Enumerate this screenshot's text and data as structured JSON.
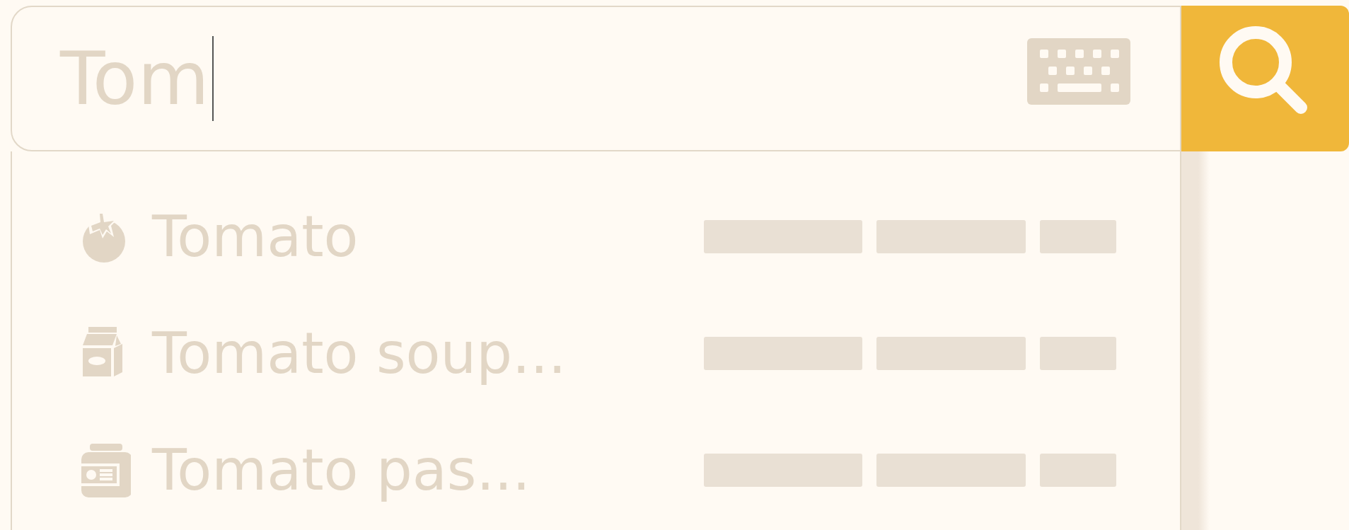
{
  "search": {
    "value": "Tom"
  },
  "results": [
    {
      "label": "Tomato",
      "kind": "tomato"
    },
    {
      "label": "Tomato soup...",
      "kind": "carton"
    },
    {
      "label": "Tomato pas...",
      "kind": "jar"
    }
  ]
}
